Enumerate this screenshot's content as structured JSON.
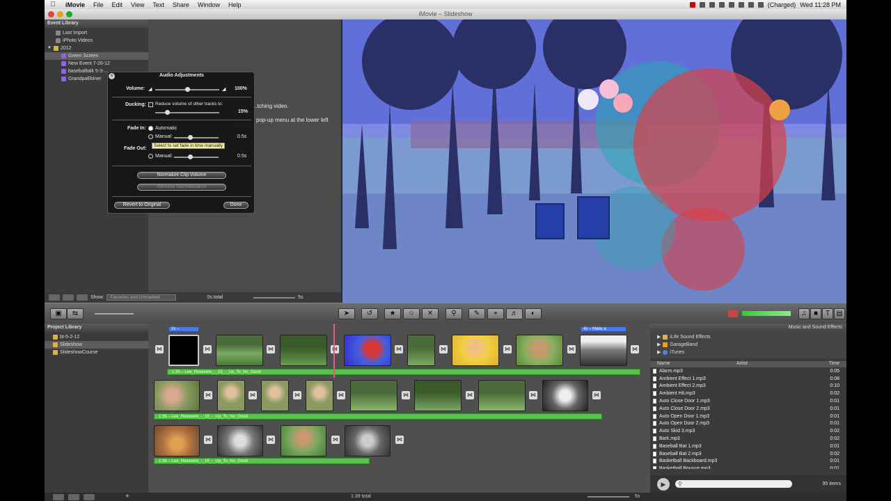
{
  "menubar": {
    "apple": "",
    "app": "iMovie",
    "items": [
      "File",
      "Edit",
      "View",
      "Text",
      "Share",
      "Window",
      "Help"
    ],
    "battery": "(Charged)",
    "clock": "Wed 11:28 PM"
  },
  "window": {
    "title": "iMovie – Slideshow"
  },
  "event_library": {
    "header": "Event Library",
    "items": [
      {
        "label": "Last Import",
        "indent": 1
      },
      {
        "label": "iPhoto Videos",
        "indent": 1
      },
      {
        "label": "2012",
        "indent": 0
      },
      {
        "label": "Green Screen",
        "indent": 2
      },
      {
        "label": "New Event 7-26-12",
        "indent": 2
      },
      {
        "label": "baseballtalk 5-3-...",
        "indent": 2
      },
      {
        "label": "GrandpaEbiner",
        "indent": 2
      }
    ]
  },
  "event_browser": {
    "text1": "...tching video.",
    "text2": "pop-up menu at the lower left",
    "text3": "corner"
  },
  "event_bottom": {
    "show_label": "Show:",
    "show_value": "Favorites and Unmarked",
    "total": "0s total",
    "zoom": "5s"
  },
  "audio_dialog": {
    "title": "Audio Adjustments",
    "volume_label": "Volume:",
    "volume_value": "100%",
    "volume_level": 0.5,
    "ducking_label": "Ducking:",
    "ducking_text": "Reduce volume of other tracks to:",
    "ducking_value": "15%",
    "fade_in_label": "Fade In:",
    "automatic": "Automatic",
    "manual": "Manual:",
    "fade_in_value": "0.5s",
    "tooltip": "Select to set fade in time manually",
    "fade_out_label": "Fade Out:",
    "fade_out_value": "0.5s",
    "normalize": "Normalize Clip Volume",
    "remove_normalization": "Remove Normalization",
    "revert": "Revert to Original",
    "done": "Done"
  },
  "project_library": {
    "header": "Project Library",
    "items": [
      {
        "label": "bt-5-2-12",
        "selected": false
      },
      {
        "label": "Slideshow",
        "selected": true
      },
      {
        "label": "SlideshowCourse",
        "selected": false
      }
    ]
  },
  "project": {
    "tag1": "2s –",
    "tag2": "4s – Make a",
    "music_row1": "1:35 – Lee_Rosevere_-_15_-_Up_To_No_Good",
    "music_row2": "1:35 – Lee_Rosevere_-_15_-_Up_To_No_Good",
    "music_row3": "1:35 – Lee_Rosevere_-_15_-_Up_To_No_Good"
  },
  "music_panel": {
    "header": "Music and Sound Effects",
    "sources": [
      "iLife Sound Effects",
      "GarageBand",
      "iTunes"
    ],
    "col_name": "Name",
    "col_artist": "Artist",
    "col_time": "Time",
    "rows": [
      {
        "name": "Alarm.mp3",
        "time": "0:05"
      },
      {
        "name": "Ambient Effect 1.mp3",
        "time": "0:08"
      },
      {
        "name": "Ambient Effect 2.mp3",
        "time": "0:10"
      },
      {
        "name": "Ambient Hit.mp3",
        "time": "0:02"
      },
      {
        "name": "Auto Close Door 1.mp3",
        "time": "0:01"
      },
      {
        "name": "Auto Close Door 2.mp3",
        "time": "0:01"
      },
      {
        "name": "Auto Open Door 1.mp3",
        "time": "0:01"
      },
      {
        "name": "Auto Open Door 2.mp3",
        "time": "0:01"
      },
      {
        "name": "Auto Skid 3.mp3",
        "time": "0:02"
      },
      {
        "name": "Bark.mp3",
        "time": "0:02"
      },
      {
        "name": "Baseball Bat 1.mp3",
        "time": "0:01"
      },
      {
        "name": "Baseball Bat 2.mp3",
        "time": "0:02"
      },
      {
        "name": "Basketball Backboard.mp3",
        "time": "0:01"
      },
      {
        "name": "Basketball Bounce.mp3",
        "time": "0:01"
      }
    ],
    "count": "95 items"
  },
  "status": {
    "total": "1:39 total",
    "zoom": "5s"
  },
  "colors": {
    "timeline_bg": "#4f4f4f",
    "music_green": "#5ac24a",
    "title_blue": "#4a7ae8",
    "viewer_tint": "#5a5ad0"
  }
}
